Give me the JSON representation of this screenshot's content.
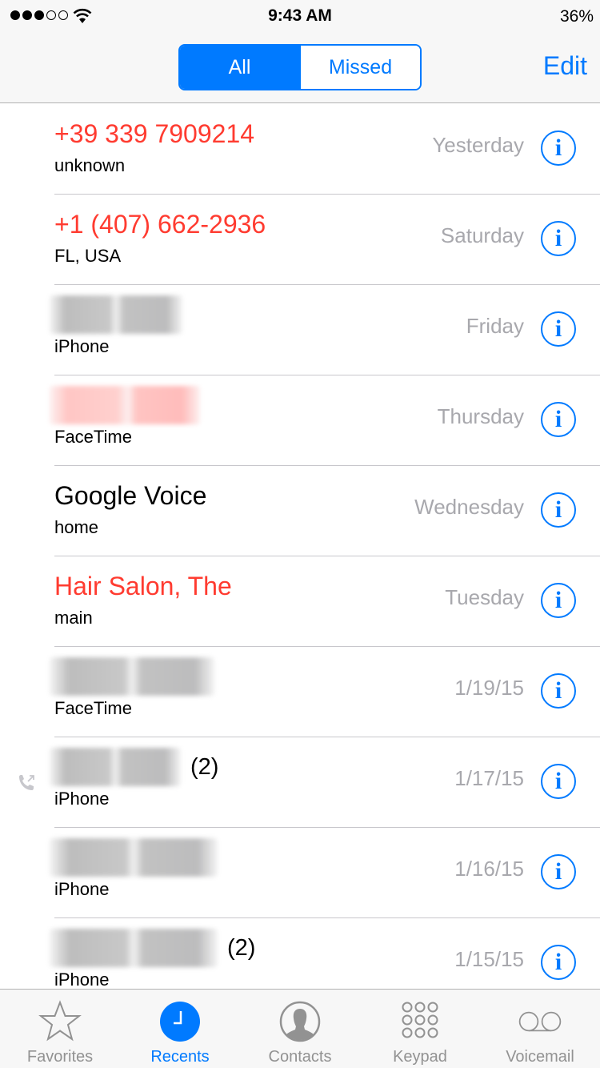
{
  "status_bar": {
    "signal_bars_filled": 3,
    "signal_bars_total": 5,
    "time": "9:43 AM",
    "battery": "36%"
  },
  "nav": {
    "segments": [
      {
        "label": "All",
        "selected": true
      },
      {
        "label": "Missed",
        "selected": false
      }
    ],
    "edit_label": "Edit"
  },
  "calls": [
    {
      "name": "+39 339 7909214",
      "missed": true,
      "redacted": false,
      "count": "",
      "label": "unknown",
      "date": "Yesterday",
      "outgoing": false
    },
    {
      "name": "+1 (407) 662-2936",
      "missed": true,
      "redacted": false,
      "count": "",
      "label": "FL, USA",
      "date": "Saturday",
      "outgoing": false
    },
    {
      "name": "",
      "missed": false,
      "redacted": true,
      "count": "",
      "label": "iPhone",
      "date": "Friday",
      "outgoing": false
    },
    {
      "name": "",
      "missed": true,
      "redacted": true,
      "count": "",
      "label": "FaceTime",
      "date": "Thursday",
      "outgoing": false
    },
    {
      "name": "Google Voice",
      "missed": false,
      "redacted": false,
      "count": "",
      "label": "home",
      "date": "Wednesday",
      "outgoing": false
    },
    {
      "name": "Hair Salon, The",
      "missed": true,
      "redacted": false,
      "count": "",
      "label": "main",
      "date": "Tuesday",
      "outgoing": false
    },
    {
      "name": "",
      "missed": false,
      "redacted": true,
      "count": "",
      "label": "FaceTime",
      "date": "1/19/15",
      "outgoing": false
    },
    {
      "name": "",
      "missed": false,
      "redacted": true,
      "count": "(2)",
      "label": "iPhone",
      "date": "1/17/15",
      "outgoing": true
    },
    {
      "name": "",
      "missed": false,
      "redacted": true,
      "count": "",
      "label": "iPhone",
      "date": "1/16/15",
      "outgoing": false
    },
    {
      "name": "",
      "missed": false,
      "redacted": true,
      "count": "(2)",
      "label": "iPhone",
      "date": "1/15/15",
      "outgoing": false
    }
  ],
  "tabbar": {
    "tabs": [
      {
        "label": "Favorites",
        "icon": "star-icon",
        "active": false
      },
      {
        "label": "Recents",
        "icon": "clock-icon",
        "active": true
      },
      {
        "label": "Contacts",
        "icon": "contact-icon",
        "active": false
      },
      {
        "label": "Keypad",
        "icon": "keypad-icon",
        "active": false
      },
      {
        "label": "Voicemail",
        "icon": "voicemail-icon",
        "active": false
      }
    ]
  },
  "colors": {
    "accent": "#007aff",
    "missed": "#ff3b30",
    "secondary_text": "#a8a8ad",
    "tab_inactive": "#929292"
  }
}
